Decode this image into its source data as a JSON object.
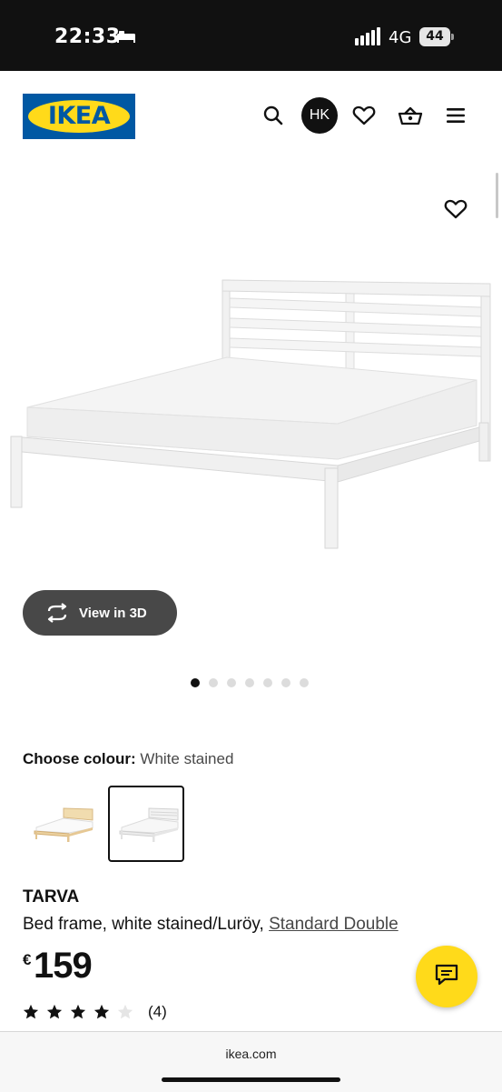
{
  "status": {
    "time": "22:33",
    "network": "4G",
    "battery": "44"
  },
  "header": {
    "logo_text": "IKEA",
    "avatar_initials": "HK",
    "icons": [
      "search-icon",
      "heart-icon",
      "basket-icon",
      "menu-icon"
    ]
  },
  "gallery": {
    "view3d_label": "View in 3D",
    "dots_total": 7,
    "active_dot": 1
  },
  "colour": {
    "label": "Choose colour:",
    "value": "White stained",
    "options": [
      "pine-bed",
      "white-stained-bed"
    ],
    "selected_index": 1
  },
  "product": {
    "name": "TARVA",
    "description": "Bed frame, white stained/Luröy,",
    "size_link": "Standard Double",
    "currency": "€",
    "price": "159",
    "rating_stars": 4,
    "rating_max": 5,
    "review_count": "(4)"
  },
  "browser": {
    "url": "ikea.com"
  },
  "colors": {
    "ikea_blue": "#0058a3",
    "ikea_yellow": "#ffda1a",
    "dark_button": "#484848"
  }
}
